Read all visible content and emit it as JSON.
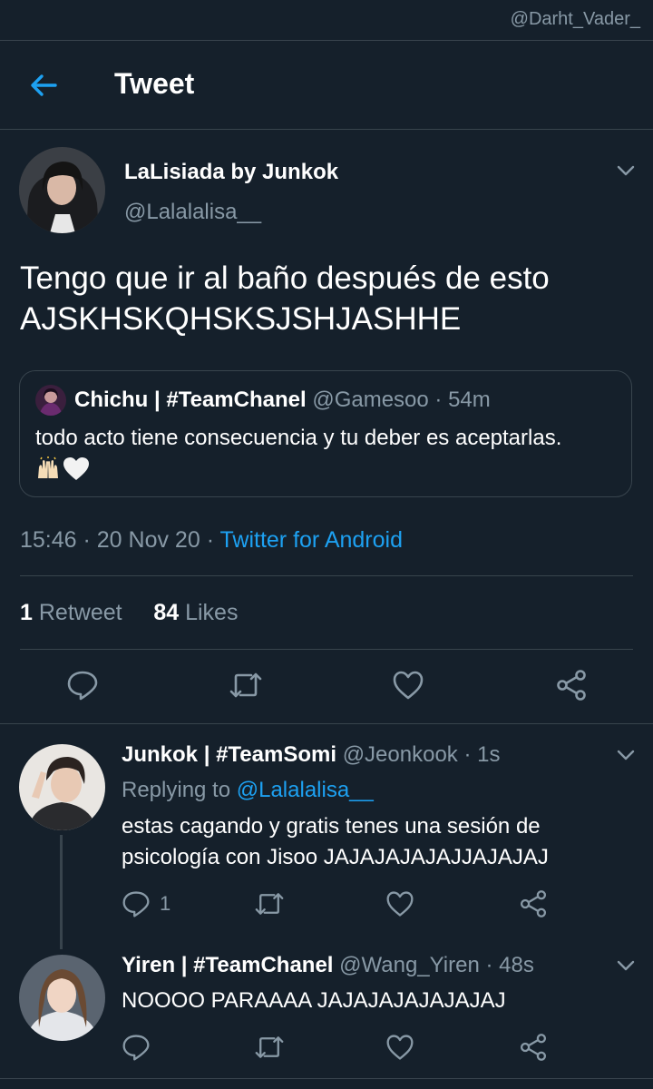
{
  "watermark": "@Darht_Vader_",
  "header": {
    "title": "Tweet"
  },
  "tweet": {
    "author_name": "LaLisiada by Junkok",
    "author_handle": "@Lalalalisa__",
    "text_line1": "Tengo que ir al baño después de esto",
    "text_line2": "AJSKHSKQHSKSJSHJASHHE",
    "quote": {
      "author_name": "Chichu | #TeamChanel",
      "author_meta": "@Gamesoo · 54m",
      "text": "todo acto tiene consecuencia y tu deber es aceptarlas.",
      "emojis": [
        "raising-hands-emoji",
        "white-heart-emoji"
      ]
    },
    "time": "15:46 · 20 Nov 20 · ",
    "source": "Twitter for Android",
    "retweet_count": "1",
    "retweet_label": "Retweet",
    "like_count": "84",
    "like_label": "Likes"
  },
  "replies": [
    {
      "name": "Junkok | #TeamSomi",
      "meta": "@Jeonkook · 1s",
      "replying_label": "Replying to ",
      "replying_to": "@Lalalalisa__",
      "text_line1": "estas cagando y gratis tenes una sesión de",
      "text_line2": "psicología con Jisoo JAJAJAJAJAJJAJAJAJ",
      "reply_count": "1"
    },
    {
      "name": "Yiren | #TeamChanel",
      "meta": "@Wang_Yiren · 48s",
      "text_line1": "NOOOO PARAAAA JAJAJAJAJAJAJAJ"
    }
  ],
  "colors": {
    "background": "#15202b",
    "accent": "#1da1f2",
    "muted": "#8899a6",
    "border": "#38444d"
  },
  "icons": [
    "back-arrow-icon",
    "chevron-down-icon",
    "reply-icon",
    "retweet-icon",
    "like-icon",
    "share-icon"
  ]
}
